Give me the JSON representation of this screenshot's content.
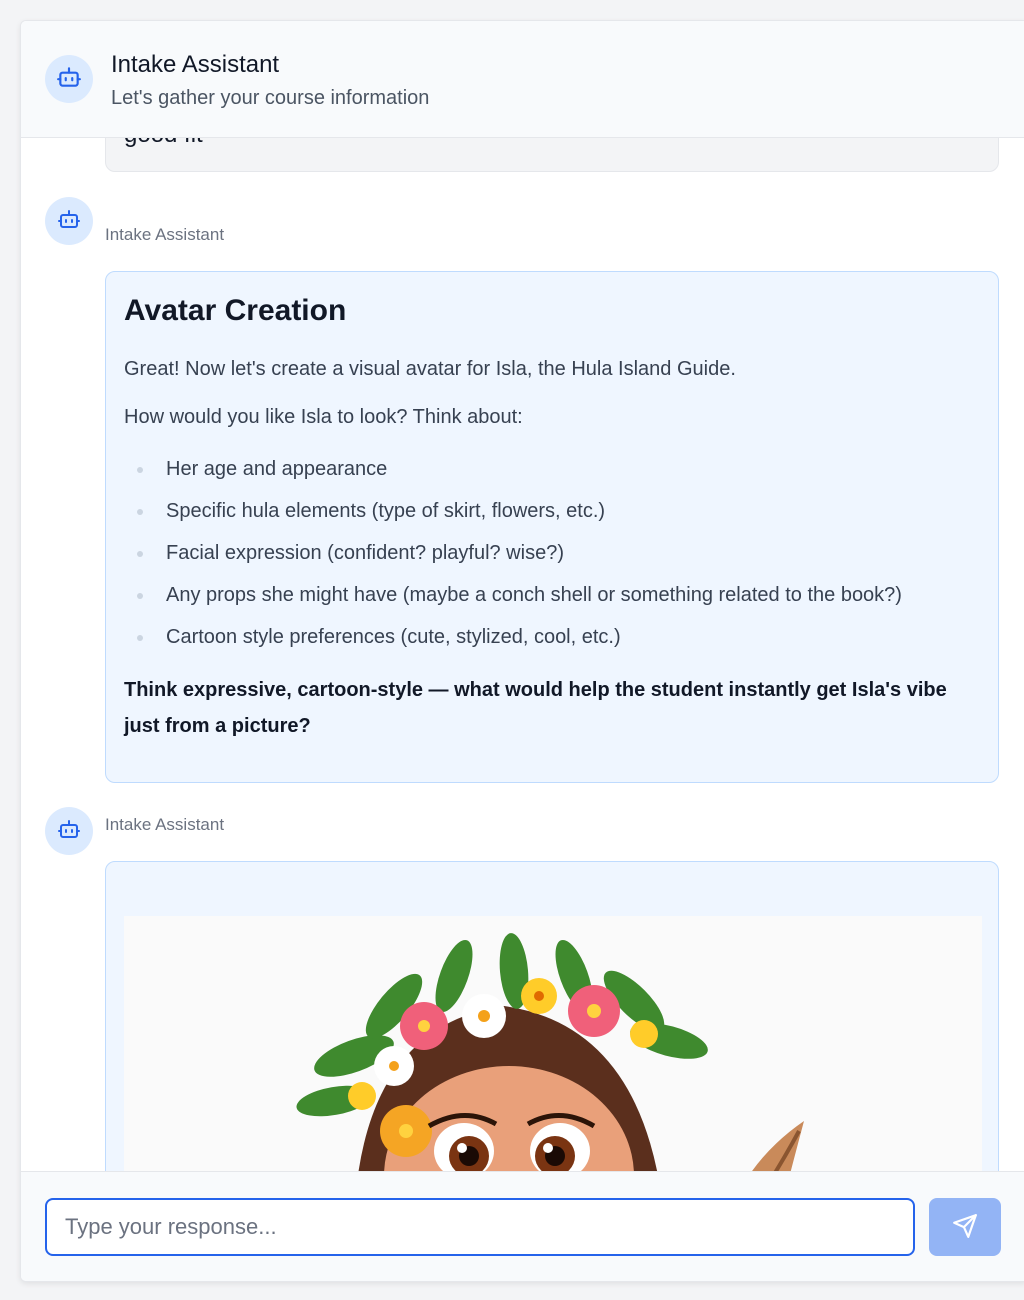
{
  "header": {
    "title": "Intake Assistant",
    "subtitle": "Let's gather your course information"
  },
  "messages": {
    "previous_snippet": "good fit",
    "msg1": {
      "sender": "Intake Assistant",
      "title": "Avatar Creation",
      "intro": "Great! Now let's create a visual avatar for Isla, the Hula Island Guide.",
      "question": "How would you like Isla to look? Think about:",
      "bullets": [
        "Her age and appearance",
        "Specific hula elements (type of skirt, flowers, etc.)",
        "Facial expression (confident? playful? wise?)",
        "Any props she might have (maybe a conch shell or something related to the book?)",
        "Cartoon style preferences (cute, stylized, cool, etc.)"
      ],
      "closing": "Think expressive, cartoon-style — what would help the student instantly get Isla's vibe just from a picture?"
    },
    "msg2": {
      "sender": "Intake Assistant",
      "image": "cartoon-avatar-isla-hula-guide"
    }
  },
  "composer": {
    "placeholder": "Type your response...",
    "send_icon": "paper-plane-icon"
  },
  "colors": {
    "accent": "#2563eb",
    "bubble_bg": "#eff6ff",
    "send_button": "#93b4f5"
  }
}
